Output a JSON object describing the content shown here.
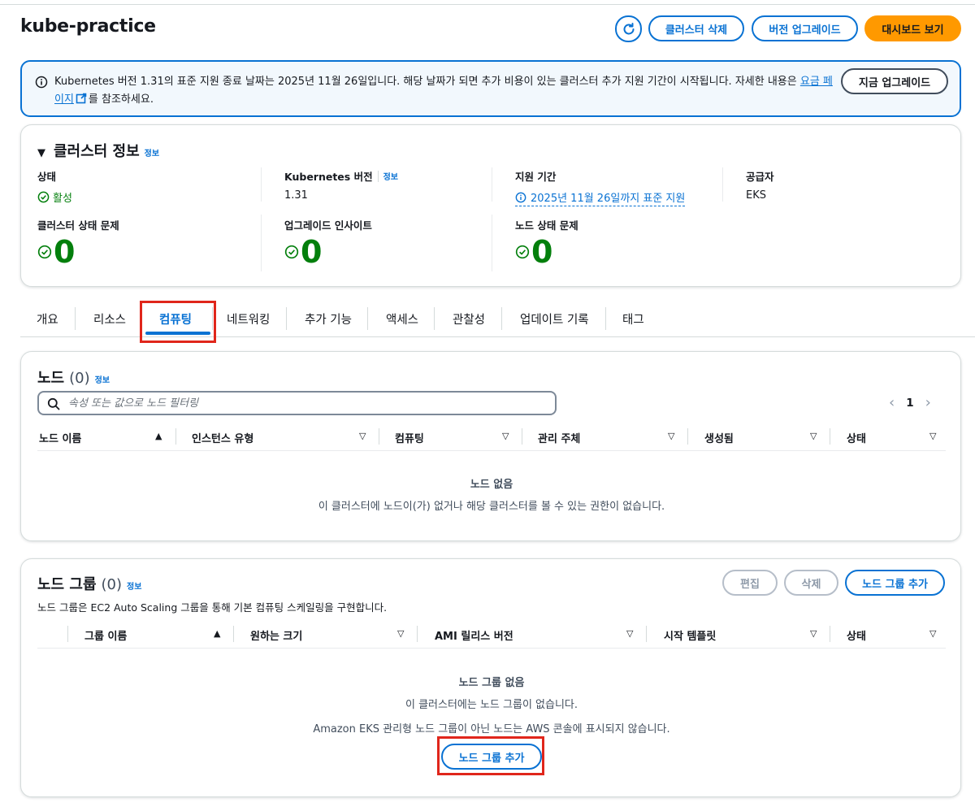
{
  "header": {
    "title": "kube-practice",
    "buttons": {
      "delete_cluster": "클러스터 삭제",
      "upgrade_version": "버전 업그레이드",
      "view_dashboard": "대시보드 보기"
    }
  },
  "alert": {
    "text_before_link": "Kubernetes 버전 1.31의 표준 지원 종료 날짜는 2025년 11월 26일입니다. 해당 날짜가 되면 추가 비용이 있는 클러스터 추가 지원 기간이 시작됩니다. 자세한 내용은 ",
    "link_text": "요금 페이지",
    "text_after_link": "를 참조하세요.",
    "action_button": "지금 업그레이드"
  },
  "cluster_info": {
    "title": "클러스터 정보",
    "info_link": "정보",
    "status_label": "상태",
    "status_value": "활성",
    "k8s_version_label": "Kubernetes 버전",
    "k8s_version_info": "정보",
    "k8s_version_value": "1.31",
    "support_period_label": "지원 기간",
    "support_period_value": "2025년 11월 26일까지 표준 지원",
    "provider_label": "공급자",
    "provider_value": "EKS",
    "cluster_health_label": "클러스터 상태 문제",
    "cluster_health_value": "0",
    "upgrade_insights_label": "업그레이드 인사이트",
    "upgrade_insights_value": "0",
    "node_health_label": "노드 상태 문제",
    "node_health_value": "0"
  },
  "tabs": [
    "개요",
    "리소스",
    "컴퓨팅",
    "네트워킹",
    "추가 기능",
    "액세스",
    "관찰성",
    "업데이트 기록",
    "태그"
  ],
  "active_tab": "컴퓨팅",
  "nodes": {
    "title": "노드",
    "count": "(0)",
    "info_link": "정보",
    "search_placeholder": "속성 또는 값으로 노드 필터링",
    "page": "1",
    "columns": [
      "노드 이름",
      "인스턴스 유형",
      "컴퓨팅",
      "관리 주체",
      "생성됨",
      "상태"
    ],
    "empty_title": "노드 없음",
    "empty_desc": "이 클러스터에 노드이(가) 없거나 해당 클러스터를 볼 수 있는 권한이 없습니다."
  },
  "node_groups": {
    "title": "노드 그룹",
    "count": "(0)",
    "info_link": "정보",
    "description": "노드 그룹은 EC2 Auto Scaling 그룹을 통해 기본 컴퓨팅 스케일링을 구현합니다.",
    "edit_button": "편집",
    "delete_button": "삭제",
    "add_button": "노드 그룹 추가",
    "columns": [
      "그룹 이름",
      "원하는 크기",
      "AMI 릴리스 버전",
      "시작 템플릿",
      "상태"
    ],
    "empty_title": "노드 그룹 없음",
    "empty_desc": "이 클러스터에는 노드 그룹이 없습니다.",
    "empty_desc2": "Amazon EKS 관리형 노드 그룹이 아닌 노드는 AWS 콘솔에 표시되지 않습니다.",
    "empty_add_button": "노드 그룹 추가"
  },
  "colors": {
    "primary_blue": "#0972d3",
    "success_green": "#037f0c",
    "accent_orange": "#ff9900",
    "highlight_red": "#e0261b"
  }
}
